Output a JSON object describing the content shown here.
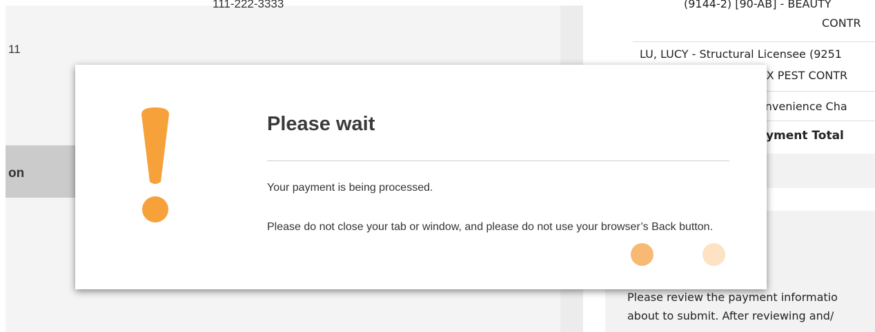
{
  "background": {
    "left": {
      "phone": "111-222-3333",
      "number": "11",
      "nav_label": "on"
    },
    "right": {
      "line_top": "(9144-2) [90-AB] - BEAUTY",
      "line_contr": "CONTR",
      "licensee": "LU, LUCY - Structural Licensee (9251",
      "company": "UX PEST CONTR",
      "convenience": "onvenience Cha",
      "payment_total": "ayment Total",
      "review_line1": "Please review the payment informatio",
      "review_line2": "about to submit. After reviewing and/"
    }
  },
  "modal": {
    "icon": "exclamation-icon",
    "title": "Please wait",
    "message": "Your payment is being processed.",
    "warning": "Please do not close your tab or window, and please do not use your browser’s Back button.",
    "loading_dots": 2
  },
  "colors": {
    "accent": "#f7a13b",
    "dot_active": "#f8b974",
    "dot_faded": "#fde2c3",
    "nav_selected": "#cbcbcb"
  }
}
